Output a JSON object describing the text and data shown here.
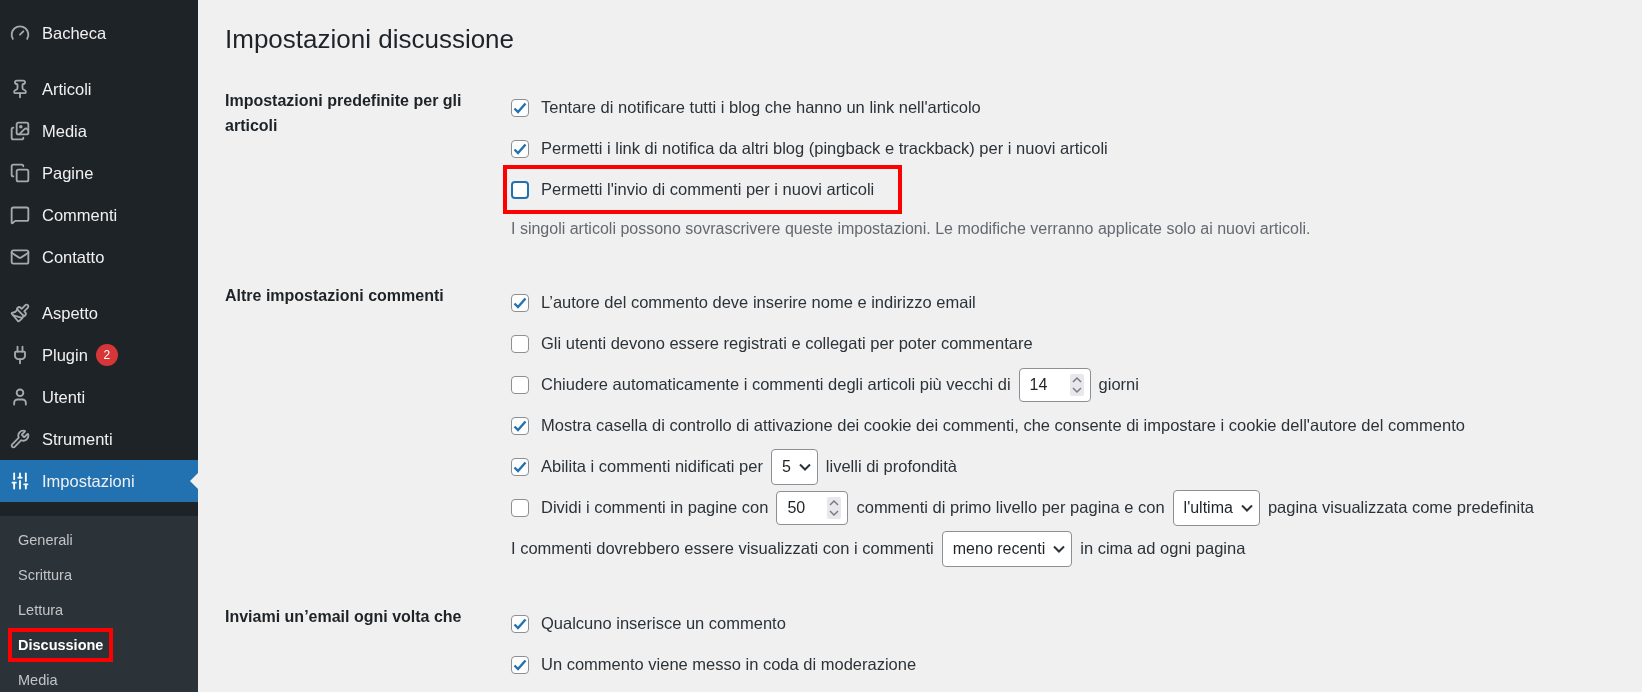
{
  "sidebar": {
    "groups": [
      [
        {
          "label": "Bacheca",
          "selected": false
        }
      ],
      [
        {
          "label": "Articoli",
          "selected": false
        },
        {
          "label": "Media",
          "selected": false
        },
        {
          "label": "Pagine",
          "selected": false
        },
        {
          "label": "Commenti",
          "selected": false
        },
        {
          "label": "Contatto",
          "selected": false
        }
      ],
      [
        {
          "label": "Aspetto",
          "selected": false
        },
        {
          "label": "Plugin",
          "selected": false,
          "badge": "2"
        },
        {
          "label": "Utenti",
          "selected": false
        },
        {
          "label": "Strumenti",
          "selected": false
        },
        {
          "label": "Impostazioni",
          "selected": true
        }
      ]
    ],
    "submenu": [
      {
        "label": "Generali",
        "selected": false,
        "highlighted": false
      },
      {
        "label": "Scrittura",
        "selected": false,
        "highlighted": false
      },
      {
        "label": "Lettura",
        "selected": false,
        "highlighted": false
      },
      {
        "label": "Discussione",
        "selected": true,
        "highlighted": true
      },
      {
        "label": "Media",
        "selected": false,
        "highlighted": false
      }
    ]
  },
  "page_title": "Impostazioni discussione",
  "sections": [
    {
      "label": "Impostazioni predefinite per gli articoli",
      "rows": [
        {
          "kind": "checkbox",
          "checked": true,
          "highlighted": false,
          "parts": [
            {
              "kind": "text",
              "text": "Tentare di notificare tutti i blog che hanno un link nell'articolo"
            }
          ]
        },
        {
          "kind": "checkbox",
          "checked": true,
          "highlighted": false,
          "parts": [
            {
              "kind": "text",
              "text": "Permetti i link di notifica da altri blog (pingback e trackback) per i nuovi articoli"
            }
          ]
        },
        {
          "kind": "checkbox",
          "checked": false,
          "highlighted": true,
          "parts": [
            {
              "kind": "text",
              "text": "Permetti l'invio di commenti per i nuovi articoli"
            }
          ]
        },
        {
          "kind": "description",
          "text": "I singoli articoli possono sovrascrivere queste impostazioni. Le modifiche verranno applicate solo ai nuovi articoli."
        }
      ]
    },
    {
      "label": "Altre impostazioni commenti",
      "rows": [
        {
          "kind": "checkbox",
          "checked": true,
          "highlighted": false,
          "parts": [
            {
              "kind": "text",
              "text": "L’autore del commento deve inserire nome e indirizzo email"
            }
          ]
        },
        {
          "kind": "checkbox",
          "checked": false,
          "highlighted": false,
          "parts": [
            {
              "kind": "text",
              "text": "Gli utenti devono essere registrati e collegati per poter commentare"
            }
          ]
        },
        {
          "kind": "checkbox",
          "checked": false,
          "highlighted": false,
          "parts": [
            {
              "kind": "text",
              "text": "Chiudere automaticamente i commenti degli articoli più vecchi di"
            },
            {
              "kind": "number",
              "value": "14"
            },
            {
              "kind": "text",
              "text": "giorni"
            }
          ]
        },
        {
          "kind": "checkbox",
          "checked": true,
          "highlighted": false,
          "parts": [
            {
              "kind": "text",
              "text": "Mostra casella di controllo di attivazione dei cookie dei commenti, che consente di impostare i cookie dell'autore del commento"
            }
          ]
        },
        {
          "kind": "checkbox",
          "checked": true,
          "highlighted": false,
          "parts": [
            {
              "kind": "text",
              "text": "Abilita i commenti nidificati per"
            },
            {
              "kind": "select",
              "value": "5"
            },
            {
              "kind": "text",
              "text": "livelli di profondità"
            }
          ]
        },
        {
          "kind": "checkbox",
          "checked": false,
          "highlighted": false,
          "parts": [
            {
              "kind": "text",
              "text": "Dividi i commenti in pagine con"
            },
            {
              "kind": "number",
              "value": "50"
            },
            {
              "kind": "text",
              "text": "commenti di primo livello per pagina e con"
            },
            {
              "kind": "select",
              "value": "l'ultima"
            },
            {
              "kind": "text",
              "text": "pagina visualizzata come predefinita"
            }
          ]
        },
        {
          "kind": "plain",
          "parts": [
            {
              "kind": "text",
              "text": "I commenti dovrebbero essere visualizzati con i commenti"
            },
            {
              "kind": "select",
              "value": "meno recenti"
            },
            {
              "kind": "text",
              "text": "in cima ad ogni pagina"
            }
          ]
        }
      ]
    },
    {
      "label": "Inviami un’email ogni volta che",
      "rows": [
        {
          "kind": "checkbox",
          "checked": true,
          "highlighted": false,
          "parts": [
            {
              "kind": "text",
              "text": "Qualcuno inserisce un commento"
            }
          ]
        },
        {
          "kind": "checkbox",
          "checked": true,
          "highlighted": false,
          "parts": [
            {
              "kind": "text",
              "text": "Un commento viene messo in coda di moderazione"
            }
          ]
        }
      ]
    }
  ]
}
